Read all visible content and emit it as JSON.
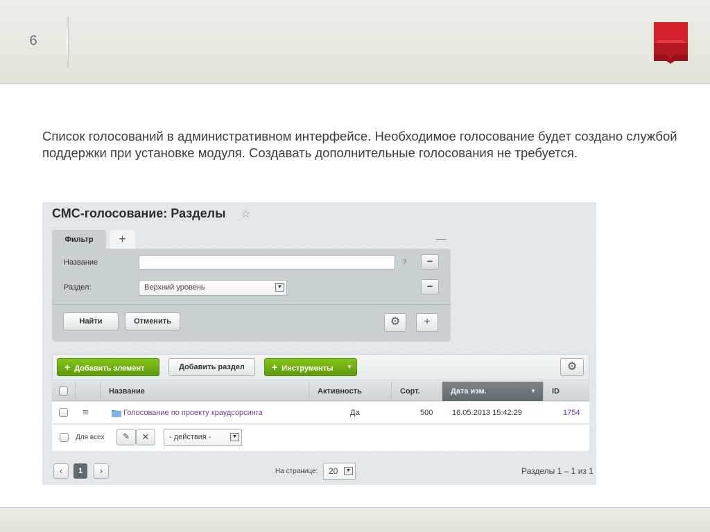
{
  "slide": {
    "number": "6",
    "caption": "Список голосований в административном интерфейсе. Необходимое голосование будет создано службой поддержки при установке модуля. Создавать дополнительные голосования не требуется."
  },
  "admin": {
    "title": "СМС-голосование: Разделы",
    "tabs": {
      "filter": "Фильтр",
      "add": "+"
    },
    "filter": {
      "name_label": "Название",
      "name_value": "",
      "help": "?",
      "section_label": "Раздел:",
      "section_value": "Верхний уровень",
      "find_btn": "Найти",
      "cancel_btn": "Отменить"
    },
    "toolbar": {
      "add_element": "Добавить элемент",
      "add_section": "Добавить раздел",
      "tools": "Инструменты"
    },
    "grid": {
      "headers": [
        "Название",
        "Активность",
        "Сорт.",
        "Дата изм.",
        "ID"
      ],
      "rows": [
        {
          "name": "Голосование по проекту краудсорсинга",
          "active": "Да",
          "sort": "500",
          "date": "16.05.2013 15:42:29",
          "id": "1754"
        }
      ],
      "for_all": "Для всех",
      "actions": "- действия -"
    },
    "pager": {
      "current_page": "1",
      "per_page_label": "На странице:",
      "per_page_value": "20",
      "summary": "Разделы 1 – 1 из 1"
    }
  },
  "colors": {
    "brand_red": "#c8202a",
    "green": "#6aab10",
    "active_header": "#6b757a",
    "link": "#6c3a9a"
  }
}
